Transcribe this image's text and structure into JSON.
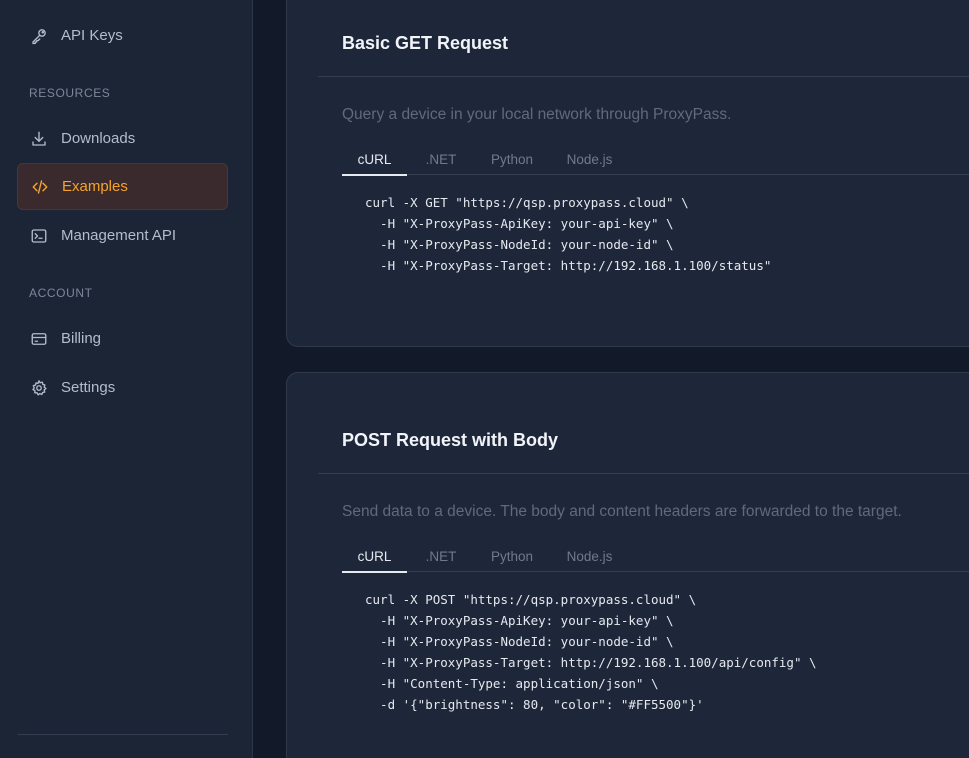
{
  "sidebar": {
    "items": [
      {
        "label": "API Keys",
        "icon": "key-icon"
      },
      {
        "label": "Downloads",
        "icon": "download-icon"
      },
      {
        "label": "Examples",
        "icon": "code-icon",
        "active": true
      },
      {
        "label": "Management API",
        "icon": "terminal-icon"
      },
      {
        "label": "Billing",
        "icon": "credit-card-icon"
      },
      {
        "label": "Settings",
        "icon": "gear-icon"
      }
    ],
    "sections": {
      "resources": "RESOURCES",
      "account": "ACCOUNT"
    }
  },
  "colors": {
    "accent": "#f3a32c",
    "background": "#121a29",
    "sidebar": "#1c2536",
    "card": "#1e2739"
  },
  "examples": [
    {
      "title": "Basic GET Request",
      "description": "Query a device in your local network through ProxyPass.",
      "tabs": [
        "cURL",
        ".NET",
        "Python",
        "Node.js"
      ],
      "active_tab": "cURL",
      "code": "curl -X GET \"https://qsp.proxypass.cloud\" \\\n  -H \"X-ProxyPass-ApiKey: your-api-key\" \\\n  -H \"X-ProxyPass-NodeId: your-node-id\" \\\n  -H \"X-ProxyPass-Target: http://192.168.1.100/status\""
    },
    {
      "title": "POST Request with Body",
      "description": "Send data to a device. The body and content headers are forwarded to the target.",
      "tabs": [
        "cURL",
        ".NET",
        "Python",
        "Node.js"
      ],
      "active_tab": "cURL",
      "code": "curl -X POST \"https://qsp.proxypass.cloud\" \\\n  -H \"X-ProxyPass-ApiKey: your-api-key\" \\\n  -H \"X-ProxyPass-NodeId: your-node-id\" \\\n  -H \"X-ProxyPass-Target: http://192.168.1.100/api/config\" \\\n  -H \"Content-Type: application/json\" \\\n  -d '{\"brightness\": 80, \"color\": \"#FF5500\"}'"
    }
  ]
}
